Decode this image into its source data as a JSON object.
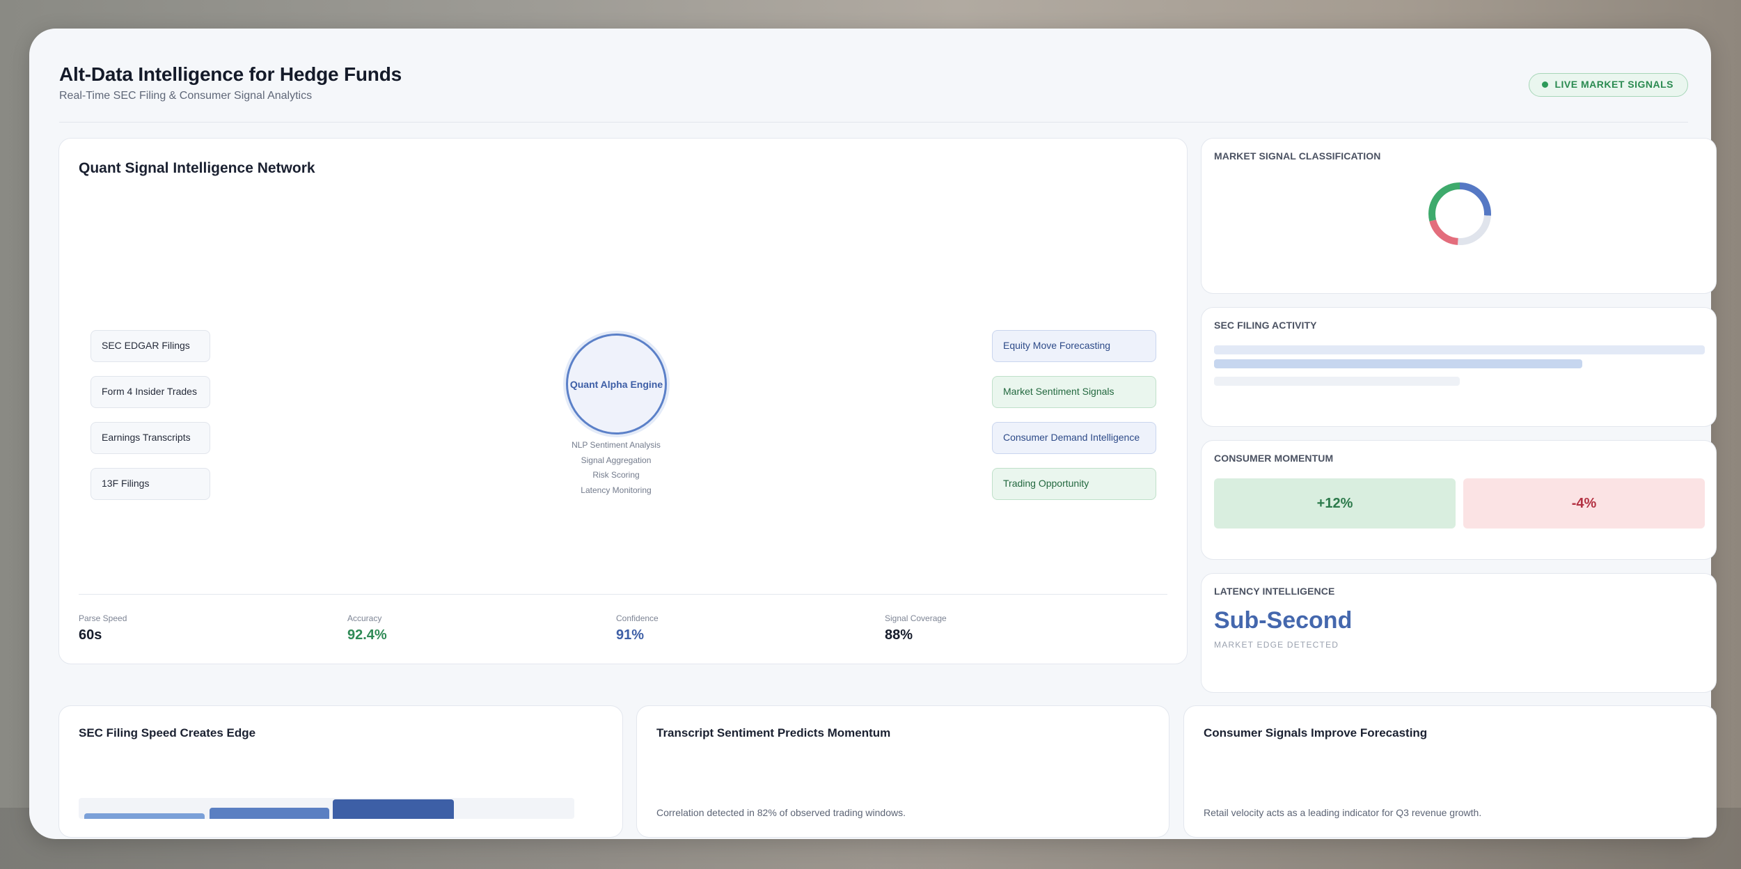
{
  "header": {
    "title": "Alt-Data Intelligence for Hedge Funds",
    "subtitle": "Real-Time SEC Filing & Consumer Signal Analytics",
    "badge": "LIVE MARKET SIGNALS"
  },
  "network": {
    "title": "Quant Signal Intelligence Network",
    "sources": [
      "SEC EDGAR Filings",
      "Form 4 Insider Trades",
      "Earnings Transcripts",
      "13F Filings"
    ],
    "engine": {
      "label": "Quant Alpha Engine",
      "steps": [
        "NLP Sentiment Analysis",
        "Signal Aggregation",
        "Risk Scoring",
        "Latency Monitoring"
      ]
    },
    "outputs": [
      {
        "label": "Equity Move Forecasting",
        "tone": "blue"
      },
      {
        "label": "Market Sentiment Signals",
        "tone": "green"
      },
      {
        "label": "Consumer Demand Intelligence",
        "tone": "blue"
      },
      {
        "label": "Trading Opportunity",
        "tone": "green"
      }
    ],
    "metrics": [
      {
        "label": "Parse Speed",
        "value": "60s",
        "color": "#161c2b"
      },
      {
        "label": "Accuracy",
        "value": "92.4%",
        "color": "#2f8a56"
      },
      {
        "label": "Confidence",
        "value": "91%",
        "color": "#3e5fa6"
      },
      {
        "label": "Signal Coverage",
        "value": "88%",
        "color": "#161c2b"
      }
    ]
  },
  "classification": {
    "title": "MARKET SIGNAL CLASSIFICATION",
    "segments": [
      {
        "fraction": 0.26,
        "color": "#5578c4"
      },
      {
        "fraction": 0.25,
        "color": "#e0e4ec"
      },
      {
        "fraction": 0.2,
        "color": "#e36d7c"
      },
      {
        "fraction": 0.29,
        "color": "#3eaa6c"
      }
    ]
  },
  "sec_activity": {
    "title": "SEC FILING ACTIVITY",
    "bars": [
      {
        "level": 1.0,
        "color": "#e2e9f6"
      },
      {
        "level": 0.75,
        "color": "#c6d6ef"
      },
      {
        "level": 0.5,
        "color": "#eef1f6"
      }
    ]
  },
  "momentum": {
    "title": "CONSUMER MOMENTUM",
    "up": "+12%",
    "down": "-4%"
  },
  "latency": {
    "title": "LATENCY INTELLIGENCE",
    "value": "Sub-Second",
    "sub": "MARKET EDGE DETECTED"
  },
  "insights": [
    {
      "title": "SEC Filing Speed Creates Edge",
      "text": ""
    },
    {
      "title": "Transcript Sentiment Predicts Momentum",
      "text": "Correlation detected in 82% of observed trading windows."
    },
    {
      "title": "Consumer Signals Improve Forecasting",
      "text": "Retail velocity acts as a leading indicator for Q3 revenue growth."
    }
  ],
  "speed_bars": [
    {
      "level": 0.28,
      "color": "#7ba0d8"
    },
    {
      "level": 0.55,
      "color": "#5a7fc2"
    },
    {
      "level": 0.95,
      "color": "#3d5fa6"
    }
  ]
}
